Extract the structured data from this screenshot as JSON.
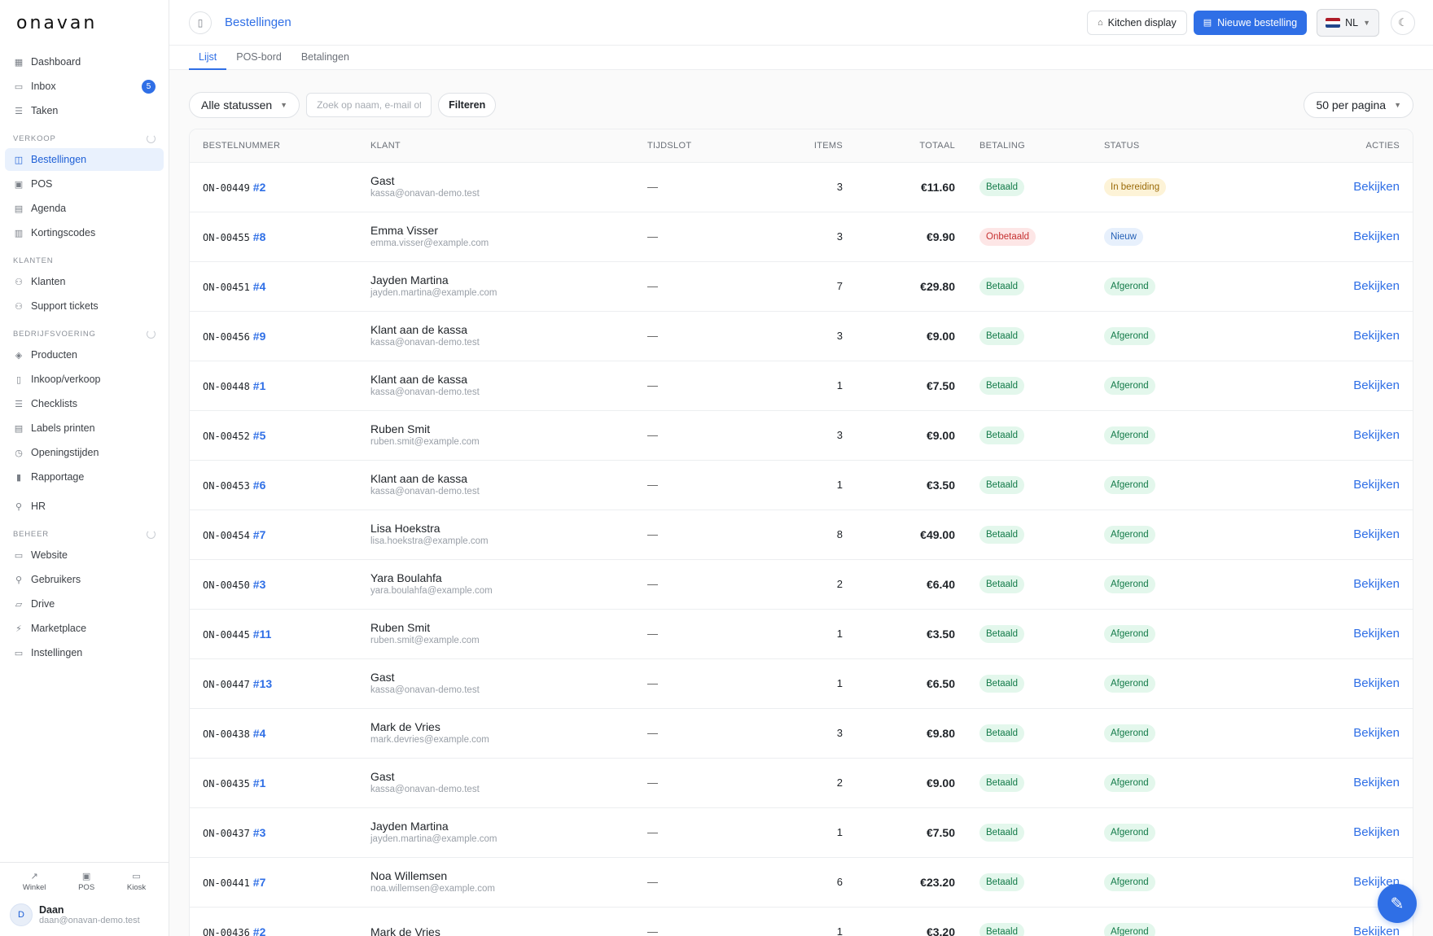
{
  "app": {
    "logo": "onavan"
  },
  "sidebar": {
    "top_items": [
      {
        "label": "Dashboard",
        "icon": "grid-icon"
      },
      {
        "label": "Inbox",
        "icon": "inbox-icon",
        "badge": "5"
      },
      {
        "label": "Taken",
        "icon": "checklist-icon"
      }
    ],
    "section_verkoop": "VERKOOP",
    "verkoop_items": [
      {
        "label": "Bestellingen",
        "icon": "bag-icon",
        "active": true
      },
      {
        "label": "POS",
        "icon": "register-icon"
      },
      {
        "label": "Agenda",
        "icon": "calendar-icon"
      },
      {
        "label": "Kortingscodes",
        "icon": "ticket-icon"
      }
    ],
    "section_klanten": "KLANTEN",
    "klanten_items": [
      {
        "label": "Klanten",
        "icon": "users-icon"
      },
      {
        "label": "Support tickets",
        "icon": "support-icon"
      }
    ],
    "section_bedrijf": "BEDRIJFSVOERING",
    "bedrijf_items": [
      {
        "label": "Producten",
        "icon": "box-icon"
      },
      {
        "label": "Inkoop/verkoop",
        "icon": "receipt-icon"
      },
      {
        "label": "Checklists",
        "icon": "checklist-icon"
      },
      {
        "label": "Labels printen",
        "icon": "printer-icon"
      },
      {
        "label": "Openingstijden",
        "icon": "clock-icon"
      },
      {
        "label": "Rapportage",
        "icon": "chart-icon"
      }
    ],
    "hr_item": {
      "label": "HR",
      "icon": "person-icon"
    },
    "section_beheer": "BEHEER",
    "beheer_items": [
      {
        "label": "Website",
        "icon": "browser-icon"
      },
      {
        "label": "Gebruikers",
        "icon": "user-icon"
      },
      {
        "label": "Drive",
        "icon": "folder-icon"
      },
      {
        "label": "Marketplace",
        "icon": "plug-icon"
      },
      {
        "label": "Instellingen",
        "icon": "settings-icon"
      }
    ],
    "quick_links": [
      {
        "label": "Winkel",
        "icon": "external-link-icon"
      },
      {
        "label": "POS",
        "icon": "register-icon"
      },
      {
        "label": "Kiosk",
        "icon": "kiosk-icon"
      }
    ],
    "user": {
      "initial": "D",
      "name": "Daan",
      "email": "daan@onavan-demo.test"
    }
  },
  "header": {
    "title": "Bestellingen",
    "kitchen_label": "Kitchen display",
    "new_order_label": "Nieuwe bestelling",
    "language": "NL"
  },
  "tabs": [
    {
      "label": "Lijst",
      "active": true
    },
    {
      "label": "POS-bord"
    },
    {
      "label": "Betalingen"
    }
  ],
  "toolbar": {
    "status_filter": "Alle statussen",
    "search_placeholder": "Zoek op naam, e-mail of bestelnummer",
    "filter_label": "Filteren",
    "per_page": "50 per pagina"
  },
  "table": {
    "headers": {
      "number": "BESTELNUMMER",
      "customer": "KLANT",
      "timeslot": "TIJDSLOT",
      "items": "ITEMS",
      "total": "TOTAAL",
      "payment": "BETALING",
      "status": "STATUS",
      "actions": "ACTIES"
    },
    "view_label": "Bekijken",
    "rows": [
      {
        "code": "ON-00449",
        "no": "#2",
        "name": "Gast",
        "email": "kassa@onavan-demo.test",
        "slot": "—",
        "items": "3",
        "total": "€11.60",
        "payment": "Betaald",
        "status": "In bereiding"
      },
      {
        "code": "ON-00455",
        "no": "#8",
        "name": "Emma Visser",
        "email": "emma.visser@example.com",
        "slot": "—",
        "items": "3",
        "total": "€9.90",
        "payment": "Onbetaald",
        "status": "Nieuw"
      },
      {
        "code": "ON-00451",
        "no": "#4",
        "name": "Jayden Martina",
        "email": "jayden.martina@example.com",
        "slot": "—",
        "items": "7",
        "total": "€29.80",
        "payment": "Betaald",
        "status": "Afgerond"
      },
      {
        "code": "ON-00456",
        "no": "#9",
        "name": "Klant aan de kassa",
        "email": "kassa@onavan-demo.test",
        "slot": "—",
        "items": "3",
        "total": "€9.00",
        "payment": "Betaald",
        "status": "Afgerond"
      },
      {
        "code": "ON-00448",
        "no": "#1",
        "name": "Klant aan de kassa",
        "email": "kassa@onavan-demo.test",
        "slot": "—",
        "items": "1",
        "total": "€7.50",
        "payment": "Betaald",
        "status": "Afgerond"
      },
      {
        "code": "ON-00452",
        "no": "#5",
        "name": "Ruben Smit",
        "email": "ruben.smit@example.com",
        "slot": "—",
        "items": "3",
        "total": "€9.00",
        "payment": "Betaald",
        "status": "Afgerond"
      },
      {
        "code": "ON-00453",
        "no": "#6",
        "name": "Klant aan de kassa",
        "email": "kassa@onavan-demo.test",
        "slot": "—",
        "items": "1",
        "total": "€3.50",
        "payment": "Betaald",
        "status": "Afgerond"
      },
      {
        "code": "ON-00454",
        "no": "#7",
        "name": "Lisa Hoekstra",
        "email": "lisa.hoekstra@example.com",
        "slot": "—",
        "items": "8",
        "total": "€49.00",
        "payment": "Betaald",
        "status": "Afgerond"
      },
      {
        "code": "ON-00450",
        "no": "#3",
        "name": "Yara Boulahfa",
        "email": "yara.boulahfa@example.com",
        "slot": "—",
        "items": "2",
        "total": "€6.40",
        "payment": "Betaald",
        "status": "Afgerond"
      },
      {
        "code": "ON-00445",
        "no": "#11",
        "name": "Ruben Smit",
        "email": "ruben.smit@example.com",
        "slot": "—",
        "items": "1",
        "total": "€3.50",
        "payment": "Betaald",
        "status": "Afgerond"
      },
      {
        "code": "ON-00447",
        "no": "#13",
        "name": "Gast",
        "email": "kassa@onavan-demo.test",
        "slot": "—",
        "items": "1",
        "total": "€6.50",
        "payment": "Betaald",
        "status": "Afgerond"
      },
      {
        "code": "ON-00438",
        "no": "#4",
        "name": "Mark de Vries",
        "email": "mark.devries@example.com",
        "slot": "—",
        "items": "3",
        "total": "€9.80",
        "payment": "Betaald",
        "status": "Afgerond"
      },
      {
        "code": "ON-00435",
        "no": "#1",
        "name": "Gast",
        "email": "kassa@onavan-demo.test",
        "slot": "—",
        "items": "2",
        "total": "€9.00",
        "payment": "Betaald",
        "status": "Afgerond"
      },
      {
        "code": "ON-00437",
        "no": "#3",
        "name": "Jayden Martina",
        "email": "jayden.martina@example.com",
        "slot": "—",
        "items": "1",
        "total": "€7.50",
        "payment": "Betaald",
        "status": "Afgerond"
      },
      {
        "code": "ON-00441",
        "no": "#7",
        "name": "Noa Willemsen",
        "email": "noa.willemsen@example.com",
        "slot": "—",
        "items": "6",
        "total": "€23.20",
        "payment": "Betaald",
        "status": "Afgerond"
      },
      {
        "code": "ON-00436",
        "no": "#2",
        "name": "Mark de Vries",
        "email": "",
        "slot": "—",
        "items": "1",
        "total": "€3.20",
        "payment": "Betaald",
        "status": "Afgerond"
      }
    ]
  },
  "colors": {
    "accent": "#2f6fe6",
    "paid_bg": "#e3f7ec",
    "unpaid_bg": "#fde6e6",
    "prep_bg": "#fdf3d7",
    "new_bg": "#e7f0fc"
  }
}
